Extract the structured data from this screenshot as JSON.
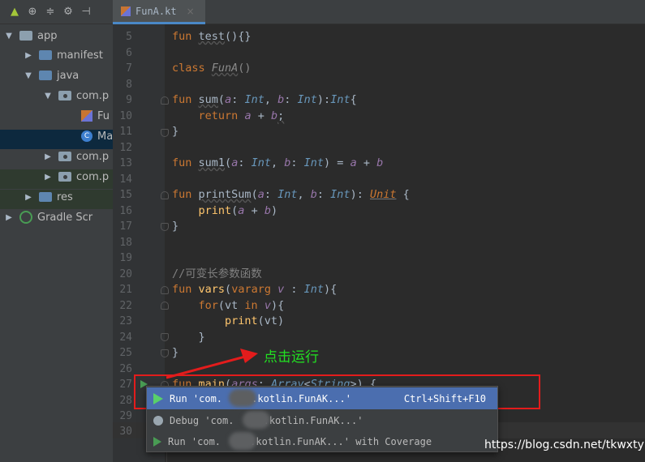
{
  "tab": {
    "filename": "FunA.kt",
    "close_glyph": "×"
  },
  "tree": [
    {
      "arrow": "▼",
      "label": "app"
    },
    {
      "arrow": "▶",
      "label": "manifest"
    },
    {
      "arrow": "▼",
      "label": "java"
    },
    {
      "arrow": "▼",
      "label": "com.p"
    },
    {
      "arrow": "",
      "label": "Fu"
    },
    {
      "arrow": "",
      "label": "Ma"
    },
    {
      "arrow": "▶",
      "label": "com.p"
    },
    {
      "arrow": "▶",
      "label": "com.p"
    },
    {
      "arrow": "▶",
      "label": "res"
    },
    {
      "arrow": "▶",
      "label": "Gradle Scr"
    }
  ],
  "line_numbers": [
    "5",
    "6",
    "7",
    "8",
    "9",
    "10",
    "11",
    "12",
    "13",
    "14",
    "15",
    "16",
    "17",
    "18",
    "19",
    "20",
    "21",
    "22",
    "23",
    "24",
    "25",
    "26",
    "27",
    "28",
    "29",
    "30"
  ],
  "annotation": "点击运行",
  "popup": {
    "items": [
      {
        "label": "Run 'com.     .kotlin.FunAK...'",
        "shortcut": "Ctrl+Shift+F10"
      },
      {
        "label": "Debug 'com.     .kotlin.FunAK...'",
        "shortcut": ""
      },
      {
        "label": "Run 'com.     .kotlin.FunAK...' with Coverage",
        "shortcut": ""
      }
    ]
  },
  "watermark": "https://blog.csdn.net/tkwxty",
  "colors": {
    "accent": "#4b6eaf",
    "annotation": "#22e022",
    "highlight_box": "#e31c1c"
  }
}
